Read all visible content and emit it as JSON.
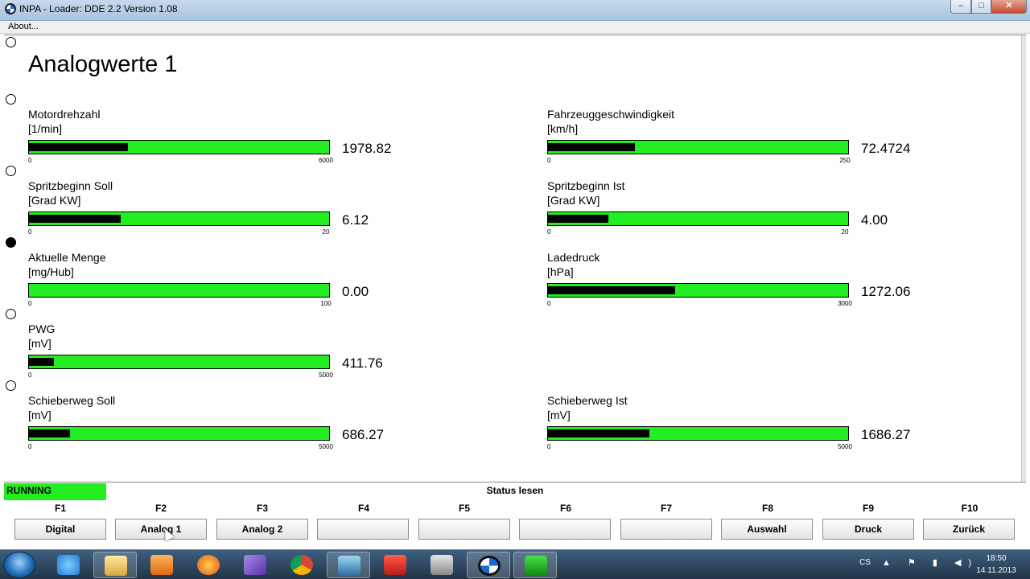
{
  "window": {
    "title": "INPA - Loader:  DDE 2.2 Version 1.08",
    "min_glyph": "–",
    "max_glyph": "□",
    "close_glyph": "✕"
  },
  "menu": {
    "about": "About..."
  },
  "page": {
    "title": "Analogwerte 1"
  },
  "gauges": [
    {
      "label": "Motordrehzahl",
      "unit": "[1/min]",
      "value": "1978.82",
      "min": "0",
      "max": "6000",
      "level": 0.33
    },
    {
      "label": "Fahrzeuggeschwindigkeit",
      "unit": "[km/h]",
      "value": "72.4724",
      "min": "0",
      "max": "250",
      "level": 0.29
    },
    {
      "label": "Spritzbeginn Soll",
      "unit": "[Grad KW]",
      "value": "6.12",
      "min": "0",
      "max": "20",
      "level": 0.306
    },
    {
      "label": "Spritzbeginn Ist",
      "unit": "[Grad KW]",
      "value": "4.00",
      "min": "0",
      "max": "20",
      "level": 0.2
    },
    {
      "label": "Aktuelle Menge",
      "unit": "[mg/Hub]",
      "value": "0.00",
      "min": "0",
      "max": "100",
      "level": 0.0
    },
    {
      "label": "Ladedruck",
      "unit": "[hPa]",
      "value": "1272.06",
      "min": "0",
      "max": "3000",
      "level": 0.424
    },
    {
      "label": "PWG",
      "unit": "[mV]",
      "value": "411.76",
      "min": "0",
      "max": "5000",
      "level": 0.082
    },
    {
      "label": "Schieberweg Soll",
      "unit": "[mV]",
      "value": "686.27",
      "min": "0",
      "max": "5000",
      "level": 0.137
    },
    {
      "label": "Schieberweg Ist",
      "unit": "[mV]",
      "value": "1686.27",
      "min": "0",
      "max": "5000",
      "level": 0.337
    }
  ],
  "status": {
    "running": "RUNNING",
    "text": "Status lesen"
  },
  "function_keys": [
    {
      "key": "F1",
      "label": "Digital"
    },
    {
      "key": "F2",
      "label": "Analog 1"
    },
    {
      "key": "F3",
      "label": "Analog 2"
    },
    {
      "key": "F4",
      "label": ""
    },
    {
      "key": "F5",
      "label": ""
    },
    {
      "key": "F6",
      "label": ""
    },
    {
      "key": "F7",
      "label": ""
    },
    {
      "key": "F8",
      "label": "Auswahl"
    },
    {
      "key": "F9",
      "label": "Druck"
    },
    {
      "key": "F10",
      "label": "Zurück"
    }
  ],
  "taskbar": {
    "items": [
      "internet-explorer-icon",
      "file-explorer-icon",
      "media-player-icon",
      "firefox-icon",
      "visual-studio-icon",
      "chrome-icon",
      "monitor-app-icon",
      "acrobat-icon",
      "camera-app-icon",
      "bmw-app-icon",
      "diagnostic-app-icon"
    ],
    "language": "CS",
    "tray": "▲ ⚑ ▮ ◀)",
    "time": "18:50",
    "date": "14.11.2013"
  },
  "colors": {
    "gauge_fill": "#22ee22",
    "running_bg": "#22ee22",
    "taskbar": "#2b4560"
  }
}
